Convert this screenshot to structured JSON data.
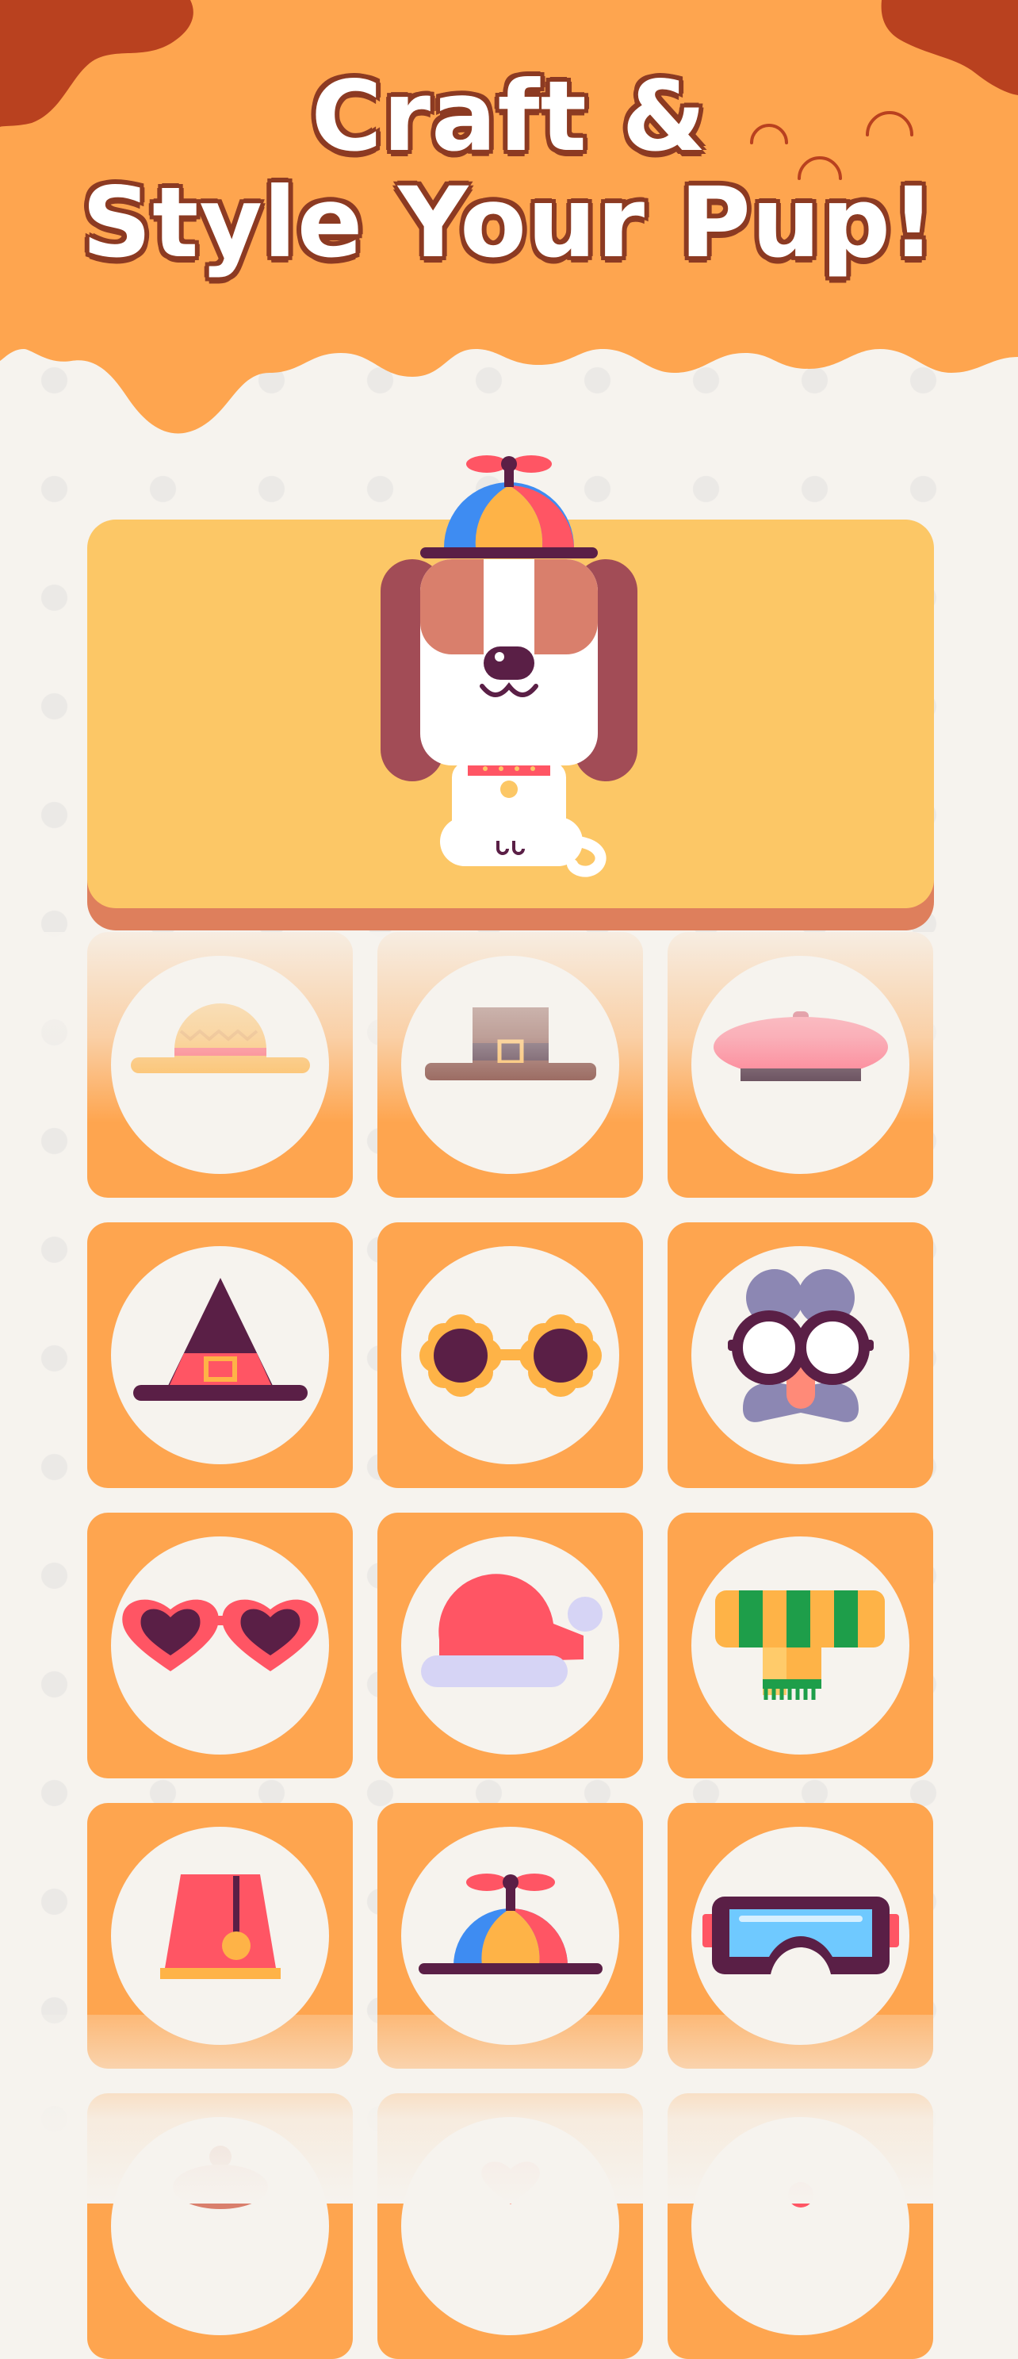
{
  "header": {
    "title_line1": "Craft &",
    "title_line2": "Style Your Pup!"
  },
  "colors": {
    "background": "#f6f3ee",
    "header_orange": "#fea54f",
    "header_dark": "#b9411f",
    "title_outline": "#8c3a22",
    "hero_yellow": "#fcc766",
    "hero_shadow": "#de7f5c",
    "tile_orange": "#fea54f"
  },
  "preview": {
    "character": "puppy",
    "wearing": "propeller-cap"
  },
  "accessories": [
    {
      "row": 0,
      "name": "straw-hat",
      "faded": true
    },
    {
      "row": 0,
      "name": "pilgrim-hat",
      "faded": true
    },
    {
      "row": 0,
      "name": "beret",
      "faded": true
    },
    {
      "row": 1,
      "name": "witch-hat",
      "faded": false
    },
    {
      "row": 1,
      "name": "flower-sunglasses",
      "faded": false
    },
    {
      "row": 1,
      "name": "disguise-glasses",
      "faded": false
    },
    {
      "row": 2,
      "name": "heart-sunglasses",
      "faded": false
    },
    {
      "row": 2,
      "name": "santa-hat",
      "faded": false
    },
    {
      "row": 2,
      "name": "striped-scarf",
      "faded": false
    },
    {
      "row": 3,
      "name": "fez-hat",
      "faded": false
    },
    {
      "row": 3,
      "name": "propeller-cap",
      "faded": false
    },
    {
      "row": 3,
      "name": "ski-goggles",
      "faded": false
    },
    {
      "row": 4,
      "name": "partially-visible-item",
      "faded": true
    },
    {
      "row": 4,
      "name": "partially-visible-item",
      "faded": true
    },
    {
      "row": 4,
      "name": "partially-visible-item",
      "faded": true
    }
  ]
}
